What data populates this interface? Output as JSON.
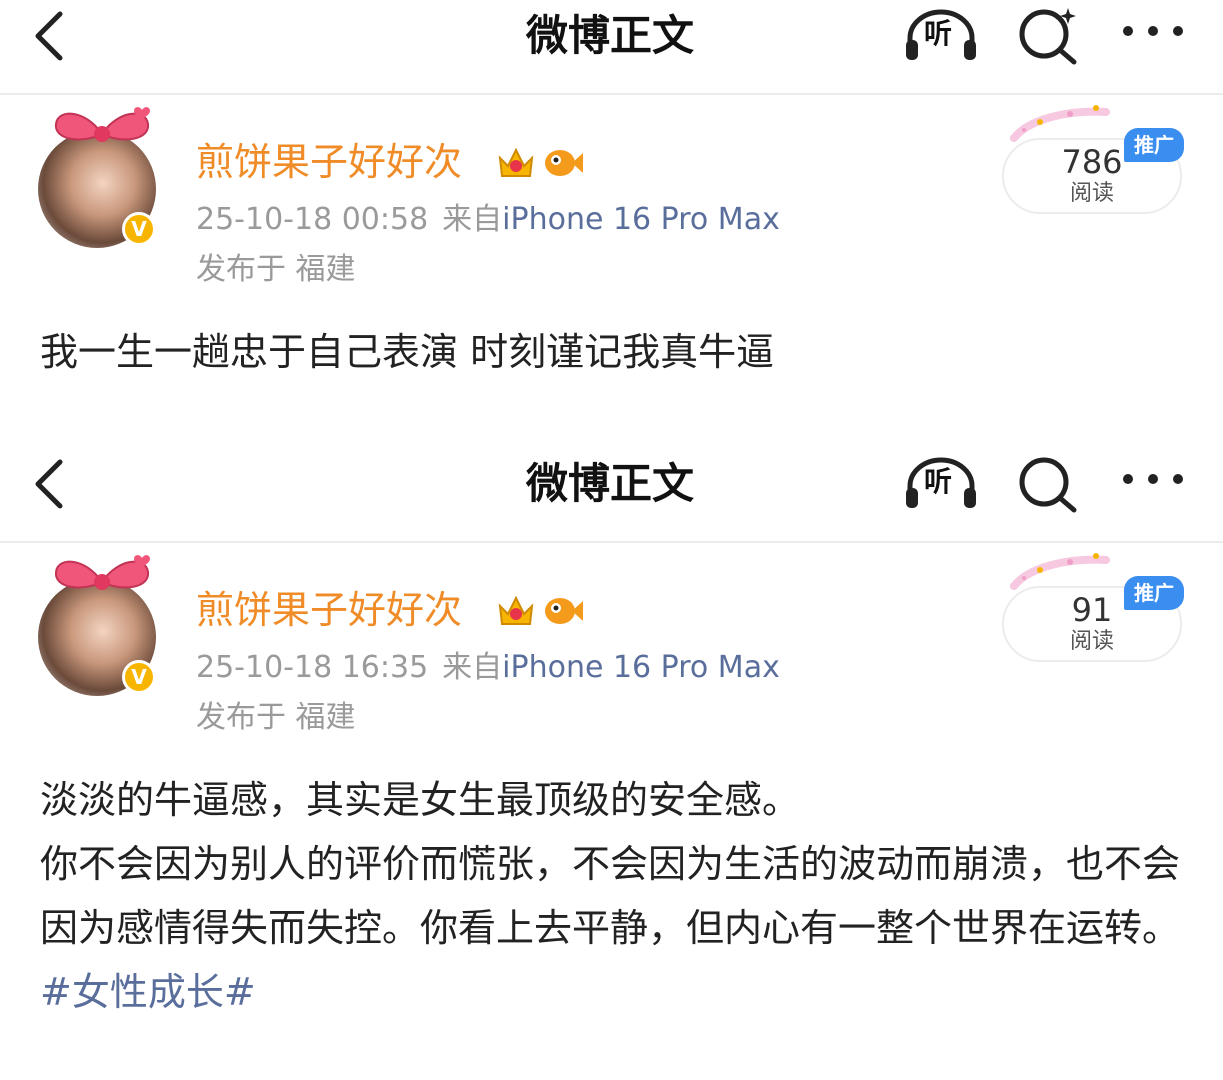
{
  "posts": [
    {
      "header": {
        "title": "微博正文",
        "listen_label": "听"
      },
      "author": {
        "name": "煎饼果子好好次",
        "verified_mark": "V"
      },
      "timestamp": "25-10-18 00:58",
      "source_prefix": "来自",
      "device": "iPhone 16 Pro Max",
      "location": "发布于 福建",
      "reads": {
        "count": "786",
        "label": "阅读",
        "promo": "推广"
      },
      "body": [
        "我一生一趟忠于自己表演 时刻谨记我真牛逼"
      ],
      "hashtag": ""
    },
    {
      "header": {
        "title": "微博正文",
        "listen_label": "听"
      },
      "author": {
        "name": "煎饼果子好好次",
        "verified_mark": "V"
      },
      "timestamp": "25-10-18 16:35",
      "source_prefix": "来自",
      "device": "iPhone 16 Pro Max",
      "location": "发布于 福建",
      "reads": {
        "count": "91",
        "label": "阅读",
        "promo": "推广"
      },
      "body": [
        "淡淡的牛逼感，其实是女生最顶级的安全感。",
        "你不会因为别人的评价而慌张，不会因为生活的波动而崩溃，也不会因为感情得失而失控。你看上去平静，但内心有一整个世界在运转。"
      ],
      "hashtag": "#女性成长#"
    }
  ],
  "colors": {
    "username": "#f08c28",
    "link": "#5a6e9c",
    "promo": "#3a8ef0",
    "verified": "#f7b500"
  }
}
